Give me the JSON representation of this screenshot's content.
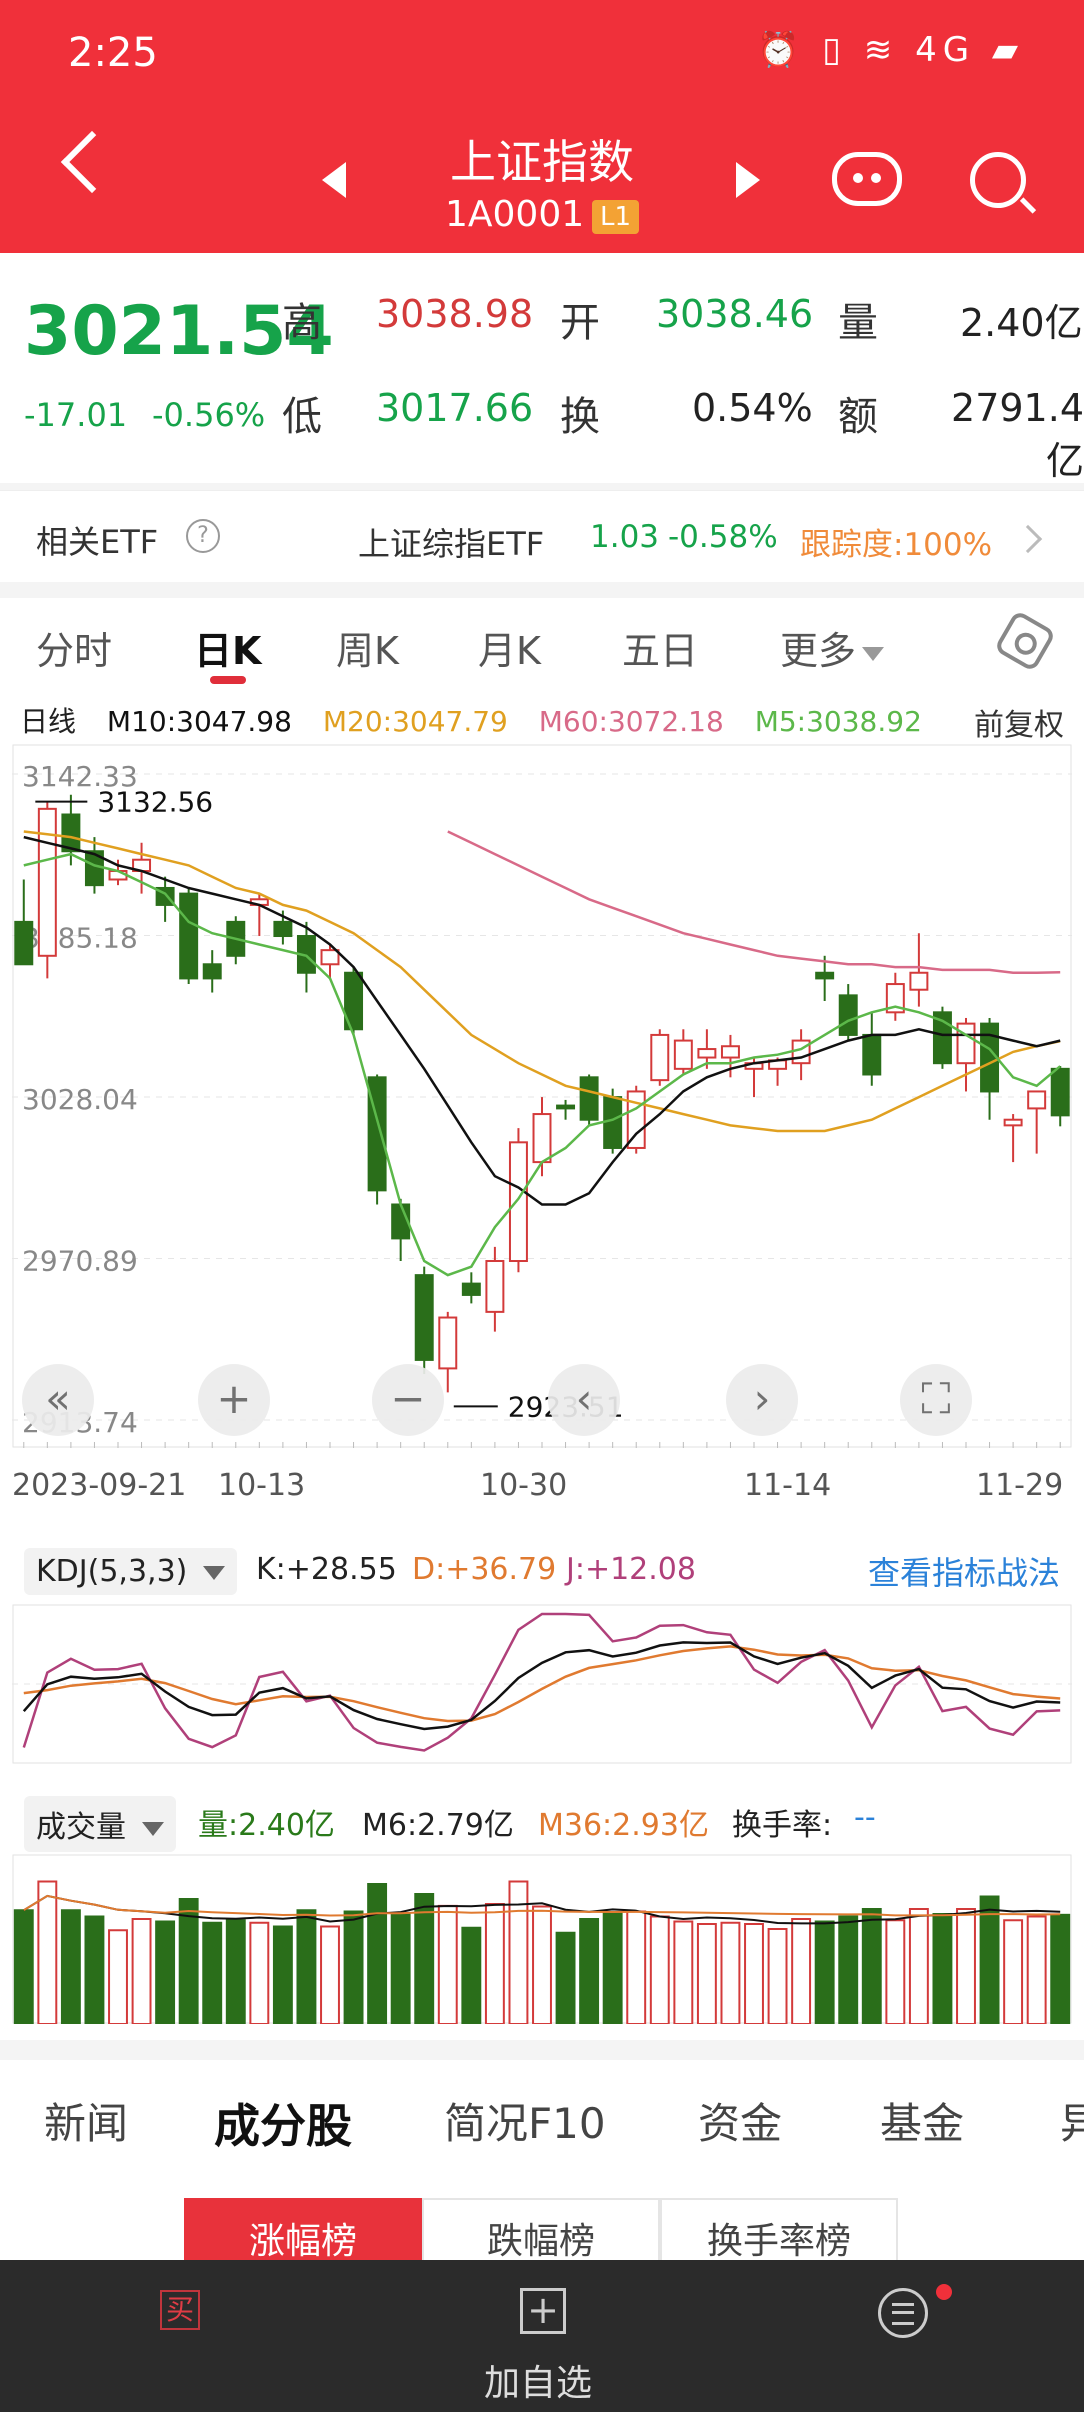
{
  "status": {
    "time": "2:25",
    "icons": "⏰ ▯ ≋ 4G ▰"
  },
  "header": {
    "title": "上证指数",
    "code": "1A0001",
    "level": "L1"
  },
  "quote": {
    "price": "3021.54",
    "change": "-17.01",
    "change_pct": "-0.56%",
    "labels": {
      "high": "高",
      "low": "低",
      "open": "开",
      "turnover": "换",
      "volume": "量",
      "amount": "额"
    },
    "high": "3038.98",
    "low": "3017.66",
    "open": "3038.46",
    "turnover_rate": "0.54%",
    "volume": "2.40亿",
    "amount": "2791.4亿"
  },
  "etf": {
    "title": "相关ETF",
    "help": "?",
    "name": "上证综指ETF",
    "price": "1.03",
    "pct": "-0.58%",
    "track": "跟踪度:100%"
  },
  "tabs": {
    "fenshi": "分时",
    "day": "日K",
    "week": "周K",
    "month": "月K",
    "five": "五日",
    "more": "更多"
  },
  "ma_legend": {
    "kind": "日线",
    "m10": "M10:3047.98",
    "m20": "M20:3047.79",
    "m60": "M60:3072.18",
    "m5": "M5:3038.92",
    "adj": "前复权"
  },
  "chart_labels": {
    "max_price": "3132.56",
    "min_price": "2923.51",
    "y_ticks": [
      "3142.33",
      "3085.18",
      "3028.04",
      "2970.89",
      "2913.74"
    ]
  },
  "x_labels": [
    "2023-09-21",
    "10-13",
    "10-30",
    "11-14",
    "11-29"
  ],
  "controls": [
    "«",
    "+",
    "−",
    "‹",
    "›",
    "⛶"
  ],
  "kdj": {
    "name": "KDJ(5,3,3)",
    "k": "K:+28.55",
    "d": "D:+36.79",
    "j": "J:+12.08",
    "link": "查看指标战法"
  },
  "volume": {
    "name": "成交量",
    "vol": "量:2.40亿",
    "m6": "M6:2.79亿",
    "m36": "M36:2.93亿",
    "turnover": "换手率:",
    "turnover_val": "--"
  },
  "subtabs": {
    "news": "新闻",
    "components": "成分股",
    "f10": "简况F10",
    "funds": "资金",
    "fund": "基金",
    "more": "异"
  },
  "ranks": {
    "up": "涨幅榜",
    "down": "跌幅榜",
    "turnover": "换手率榜"
  },
  "bottom": {
    "buy": "买",
    "add": "加自选"
  },
  "colors": {
    "red": "#d33a3a",
    "green": "#2a6e1a",
    "m10": "#111111",
    "m20": "#e0a020",
    "m60": "#d86a88",
    "m5": "#5cb84a"
  },
  "chart_data": {
    "type": "candlestick",
    "y_range": [
      2913.74,
      3142.33
    ],
    "max": 3132.56,
    "min": 2923.51,
    "candles": [
      {
        "o": 3090,
        "h": 3105,
        "l": 3080,
        "c": 3075
      },
      {
        "o": 3078,
        "h": 3132.56,
        "l": 3070,
        "c": 3130
      },
      {
        "o": 3128,
        "h": 3135,
        "l": 3110,
        "c": 3115
      },
      {
        "o": 3115,
        "h": 3120,
        "l": 3100,
        "c": 3103
      },
      {
        "o": 3105,
        "h": 3112,
        "l": 3103,
        "c": 3108
      },
      {
        "o": 3108,
        "h": 3118,
        "l": 3100,
        "c": 3112
      },
      {
        "o": 3102,
        "h": 3106,
        "l": 3090,
        "c": 3096
      },
      {
        "o": 3100,
        "h": 3102,
        "l": 3068,
        "c": 3070
      },
      {
        "o": 3075,
        "h": 3080,
        "l": 3065,
        "c": 3070
      },
      {
        "o": 3090,
        "h": 3092,
        "l": 3075,
        "c": 3078
      },
      {
        "o": 3096,
        "h": 3100,
        "l": 3085,
        "c": 3098
      },
      {
        "o": 3090,
        "h": 3094,
        "l": 3082,
        "c": 3085
      },
      {
        "o": 3085,
        "h": 3090,
        "l": 3065,
        "c": 3072
      },
      {
        "o": 3075,
        "h": 3082,
        "l": 3070,
        "c": 3080
      },
      {
        "o": 3072,
        "h": 3074,
        "l": 3050,
        "c": 3052
      },
      {
        "o": 3035,
        "h": 3036,
        "l": 2990,
        "c": 2995
      },
      {
        "o": 2990,
        "h": 2992,
        "l": 2970,
        "c": 2978
      },
      {
        "o": 2965,
        "h": 2968,
        "l": 2930,
        "c": 2935
      },
      {
        "o": 2932,
        "h": 2952,
        "l": 2923.51,
        "c": 2950
      },
      {
        "o": 2962,
        "h": 2966,
        "l": 2955,
        "c": 2958
      },
      {
        "o": 2952,
        "h": 2975,
        "l": 2945,
        "c": 2970
      },
      {
        "o": 2970,
        "h": 3017,
        "l": 2966,
        "c": 3012
      },
      {
        "o": 3005,
        "h": 3028,
        "l": 3000,
        "c": 3022
      },
      {
        "o": 3025,
        "h": 3027,
        "l": 3020,
        "c": 3024
      },
      {
        "o": 3035,
        "h": 3036,
        "l": 3018,
        "c": 3020
      },
      {
        "o": 3028,
        "h": 3031,
        "l": 3008,
        "c": 3010
      },
      {
        "o": 3010,
        "h": 3032,
        "l": 3008,
        "c": 3030
      },
      {
        "o": 3034,
        "h": 3052,
        "l": 3032,
        "c": 3050
      },
      {
        "o": 3038,
        "h": 3052,
        "l": 3036,
        "c": 3048
      },
      {
        "o": 3042,
        "h": 3052,
        "l": 3038,
        "c": 3045
      },
      {
        "o": 3042,
        "h": 3050,
        "l": 3035,
        "c": 3046
      },
      {
        "o": 3038,
        "h": 3042,
        "l": 3028,
        "c": 3040
      },
      {
        "o": 3038,
        "h": 3042,
        "l": 3032,
        "c": 3041
      },
      {
        "o": 3040,
        "h": 3052,
        "l": 3034,
        "c": 3048
      },
      {
        "o": 3072,
        "h": 3078,
        "l": 3062,
        "c": 3070
      },
      {
        "o": 3064,
        "h": 3068,
        "l": 3048,
        "c": 3050
      },
      {
        "o": 3050,
        "h": 3058,
        "l": 3032,
        "c": 3036
      },
      {
        "o": 3058,
        "h": 3072,
        "l": 3055,
        "c": 3068
      },
      {
        "o": 3066,
        "h": 3086,
        "l": 3060,
        "c": 3072
      },
      {
        "o": 3058,
        "h": 3060,
        "l": 3038,
        "c": 3040
      },
      {
        "o": 3040,
        "h": 3056,
        "l": 3030,
        "c": 3054
      },
      {
        "o": 3054,
        "h": 3056,
        "l": 3020,
        "c": 3030
      },
      {
        "o": 3018,
        "h": 3022,
        "l": 3005,
        "c": 3020
      },
      {
        "o": 3024,
        "h": 3028,
        "l": 3008,
        "c": 3030
      },
      {
        "o": 3038,
        "h": 3039,
        "l": 3017.66,
        "c": 3021.54
      }
    ],
    "ma5": [
      3110,
      3112,
      3114,
      3110,
      3108,
      3104,
      3100,
      3090,
      3086,
      3084,
      3082,
      3080,
      3078,
      3070,
      3050,
      3020,
      2990,
      2970,
      2965,
      2968,
      2982,
      2992,
      3005,
      3010,
      3018,
      3020,
      3024,
      3030,
      3036,
      3040,
      3040,
      3042,
      3043,
      3045,
      3050,
      3055,
      3058,
      3060,
      3058,
      3055,
      3050,
      3045,
      3035,
      3032,
      3038.92
    ],
    "ma10": [
      3120,
      3118,
      3116,
      3114,
      3110,
      3108,
      3105,
      3102,
      3100,
      3098,
      3096,
      3092,
      3088,
      3082,
      3074,
      3062,
      3050,
      3038,
      3025,
      3012,
      3000,
      2996,
      2990,
      2990,
      2994,
      3005,
      3015,
      3022,
      3030,
      3035,
      3038,
      3040,
      3041,
      3042,
      3045,
      3048,
      3050,
      3050,
      3052,
      3050,
      3050,
      3050,
      3048,
      3046,
      3047.98
    ],
    "ma20": [
      3122,
      3121,
      3120,
      3118,
      3116,
      3114,
      3112,
      3110,
      3106,
      3102,
      3100,
      3096,
      3094,
      3090,
      3086,
      3080,
      3074,
      3066,
      3058,
      3050,
      3045,
      3040,
      3036,
      3032,
      3030,
      3028,
      3026,
      3024,
      3022,
      3020,
      3018,
      3017,
      3016,
      3016,
      3016,
      3018,
      3020,
      3024,
      3028,
      3032,
      3036,
      3040,
      3044,
      3046,
      3047.79
    ],
    "ma60": [
      null,
      null,
      null,
      null,
      null,
      null,
      null,
      null,
      null,
      null,
      null,
      null,
      null,
      null,
      null,
      null,
      null,
      null,
      3122,
      3118,
      3114,
      3110,
      3106,
      3102,
      3098,
      3095,
      3092,
      3089,
      3086,
      3084,
      3082,
      3080,
      3078,
      3077,
      3076,
      3075,
      3075,
      3074,
      3074,
      3073,
      3073,
      3073,
      3072,
      3072,
      3072.18
    ]
  }
}
